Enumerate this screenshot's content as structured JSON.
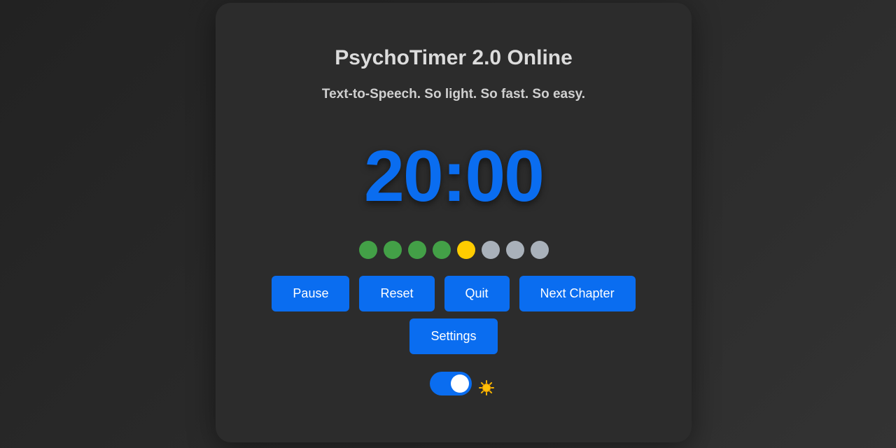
{
  "app": {
    "title": "PsychoTimer 2.0 Online",
    "subtitle": "Text-to-Speech. So light. So fast. So easy."
  },
  "timer": {
    "display": "20:00"
  },
  "progress_dots": [
    {
      "state": "done",
      "color": "#43a047"
    },
    {
      "state": "done",
      "color": "#43a047"
    },
    {
      "state": "done",
      "color": "#43a047"
    },
    {
      "state": "done",
      "color": "#43a047"
    },
    {
      "state": "current",
      "color": "#ffcc00"
    },
    {
      "state": "pending",
      "color": "#a9b1ba"
    },
    {
      "state": "pending",
      "color": "#a9b1ba"
    },
    {
      "state": "pending",
      "color": "#a9b1ba"
    }
  ],
  "buttons": {
    "pause": "Pause",
    "reset": "Reset",
    "quit": "Quit",
    "next_chapter": "Next Chapter",
    "settings": "Settings"
  },
  "theme_toggle": {
    "on": true,
    "icon": "sun-icon"
  },
  "colors": {
    "accent": "#0a6df0",
    "card": "#2c2c2c",
    "sun": "#f5b400"
  }
}
